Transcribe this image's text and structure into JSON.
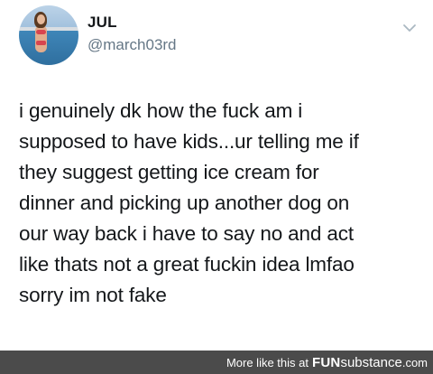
{
  "tweet": {
    "display_name": "JUL",
    "handle": "@march03rd",
    "avatar_icon": "profile-photo",
    "menu_icon": "chevron-down-icon",
    "text_lines": [
      "i genuinely dk how the fuck am i",
      "supposed to have kids...ur telling me if",
      "they suggest getting ice cream for",
      "dinner and picking up another dog on",
      "our way back i have to say no and act",
      "like thats not a great fuckin idea lmfao",
      "sorry im not fake"
    ]
  },
  "footer": {
    "more_text": "More like this at",
    "brand_bold": "FUN",
    "brand_regular": "substance",
    "brand_domain": ".com"
  }
}
